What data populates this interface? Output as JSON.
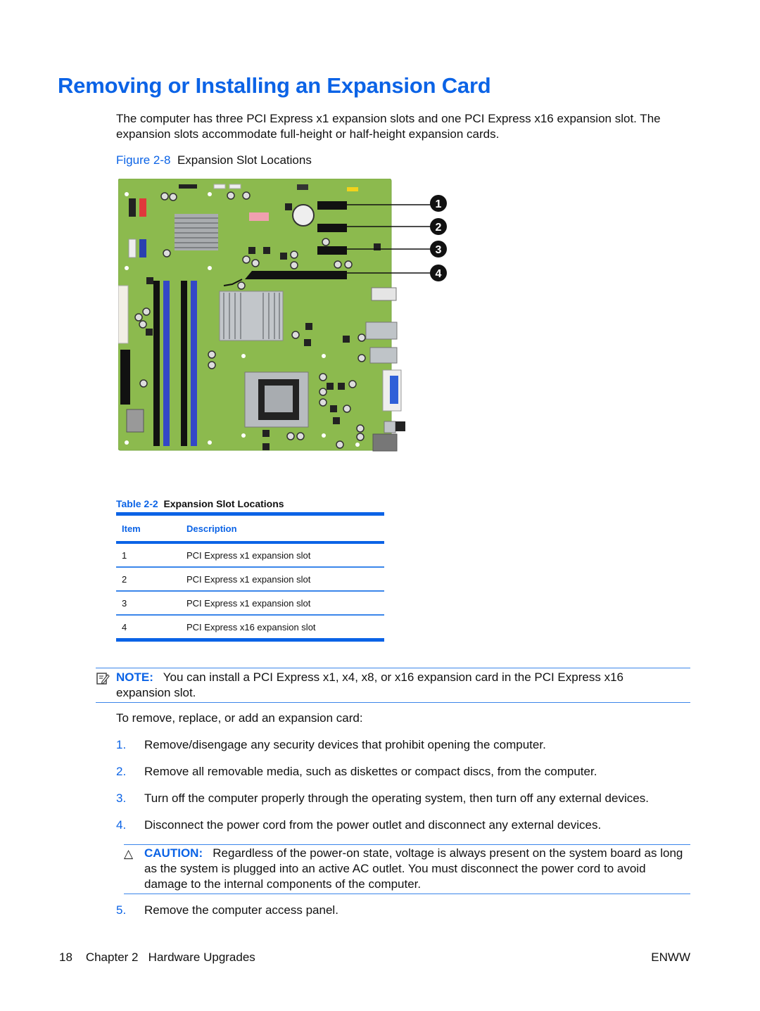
{
  "page": {
    "title": "Removing or Installing an Expansion Card",
    "intro": "The computer has three PCI Express x1 expansion slots and one PCI Express x16 expansion slot. The expansion slots accommodate full-height or half-height expansion cards.",
    "figure": {
      "label": "Figure 2-8",
      "caption": "Expansion Slot Locations",
      "callouts": [
        "1",
        "2",
        "3",
        "4"
      ],
      "image_semantic": "motherboard-illustration"
    },
    "table": {
      "label": "Table 2-2",
      "caption": "Expansion Slot Locations",
      "headers": [
        "Item",
        "Description"
      ],
      "rows": [
        {
          "item": "1",
          "description": "PCI Express x1 expansion slot"
        },
        {
          "item": "2",
          "description": "PCI Express x1 expansion slot"
        },
        {
          "item": "3",
          "description": "PCI Express x1 expansion slot"
        },
        {
          "item": "4",
          "description": "PCI Express x16 expansion slot"
        }
      ]
    },
    "note": {
      "icon": "note-pencil-icon",
      "label": "NOTE:",
      "text": "You can install a PCI Express x1, x4, x8, or x16 expansion card in the PCI Express x16",
      "text_cont": "expansion slot."
    },
    "lead": "To remove, replace, or add an expansion card:",
    "steps": [
      {
        "num": "1.",
        "text": "Remove/disengage any security devices that prohibit opening the computer."
      },
      {
        "num": "2.",
        "text": "Remove all removable media, such as diskettes or compact discs, from the computer."
      },
      {
        "num": "3.",
        "text": "Turn off the computer properly through the operating system, then turn off any external devices."
      },
      {
        "num": "4.",
        "text": "Disconnect the power cord from the power outlet and disconnect any external devices."
      },
      {
        "num": "5.",
        "text": "Remove the computer access panel."
      }
    ],
    "caution": {
      "icon": "caution-triangle-icon",
      "glyph": "△",
      "label": "CAUTION:",
      "text": "Regardless of the power-on state, voltage is always present on the system board as long as the system is plugged into an active AC outlet. You must disconnect the power cord to avoid damage to the internal components of the computer."
    },
    "footer": {
      "page_number": "18",
      "chapter": "Chapter 2",
      "section": "Hardware Upgrades",
      "locale": "ENWW"
    },
    "colors": {
      "accent": "#0b63e6",
      "board_green": "#8cba4e"
    }
  }
}
